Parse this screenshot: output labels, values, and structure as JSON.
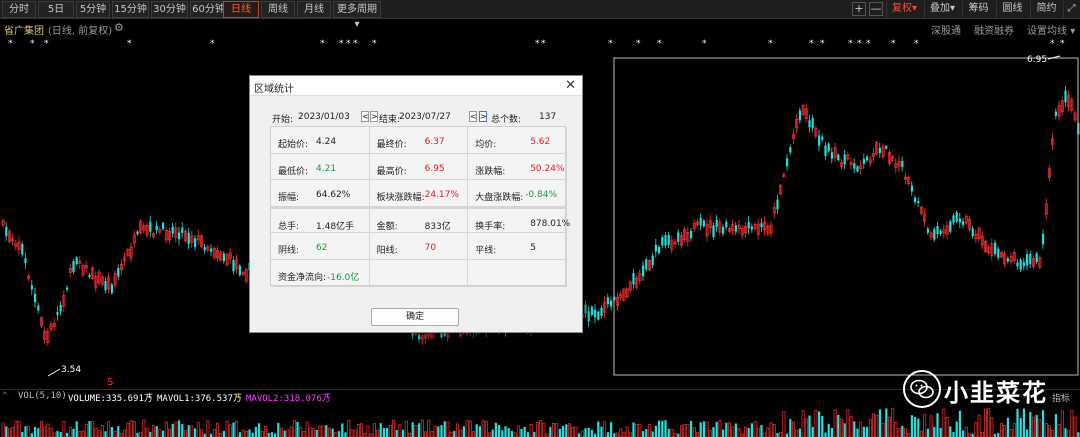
{
  "toolbar": {
    "periods": [
      "分时",
      "5日",
      "5分钟",
      "15分钟",
      "30分钟",
      "60分钟",
      "日线",
      "周线",
      "月线",
      "更多周期"
    ],
    "active_period": "日线",
    "right": {
      "plus": "+",
      "minus": "—",
      "adjust": "复权",
      "overlay": "叠加",
      "chips": "筹码",
      "circle": "圆线",
      "brief": "简约",
      "zoom": "⤢"
    }
  },
  "subbar": {
    "stock_name": "省广集团",
    "stock_sub": "(日线, 前复权)",
    "links": [
      "深股通",
      "融资融券",
      "设置均线"
    ]
  },
  "chart": {
    "low_label": "3.54",
    "high_label": "6.95",
    "signal_mark": "S",
    "star": "*"
  },
  "volume": {
    "label": "VOL(5,10)",
    "volume": "VOLUME:335.691万",
    "mavol1": "MAVOL1:376.537万",
    "mavol2": "MAVOL2:318.076万",
    "indicator": "指标"
  },
  "watermark": {
    "text": "小韭菜花"
  },
  "dialog": {
    "title": "区域统计",
    "close": "✕",
    "start_label": "开始:",
    "start_date": "2023/01/03",
    "end_label": "结束:",
    "end_date": "2023/07/27",
    "count_label": "总个数:",
    "count": "137",
    "prev": "<",
    "next": ">",
    "rows": [
      [
        {
          "k": "起始价:",
          "v": "4.24",
          "c": "dark"
        },
        {
          "k": "最终价:",
          "v": "6.37",
          "c": "red"
        },
        {
          "k": "均价:",
          "v": "5.62",
          "c": "red"
        }
      ],
      [
        {
          "k": "最低价:",
          "v": "4.21",
          "c": "green"
        },
        {
          "k": "最高价:",
          "v": "6.95",
          "c": "red"
        },
        {
          "k": "涨跌幅:",
          "v": "50.24%",
          "c": "red"
        }
      ],
      [
        {
          "k": "振幅:",
          "v": "64.62%",
          "c": "dark"
        },
        {
          "k": "板块涨跌幅:",
          "v": "24.17%",
          "c": "red"
        },
        {
          "k": "大盘涨跌幅:",
          "v": "-0.84%",
          "c": "green"
        }
      ],
      [
        {
          "k": "总手:",
          "v": "1.48亿手",
          "c": "dark"
        },
        {
          "k": "金额:",
          "v": "833亿",
          "c": "dark"
        },
        {
          "k": "换手率:",
          "v": "878.01%",
          "c": "dark"
        }
      ],
      [
        {
          "k": "阴线:",
          "v": "62",
          "c": "green"
        },
        {
          "k": "阳线:",
          "v": "70",
          "c": "red"
        },
        {
          "k": "平线:",
          "v": "5",
          "c": "dark"
        }
      ],
      [
        {
          "k": "资金净流向:",
          "v": "-16.0亿",
          "c": "green"
        },
        {
          "k": "",
          "v": "",
          "c": "dark"
        },
        {
          "k": "",
          "v": "",
          "c": "dark"
        }
      ]
    ],
    "ok": "确定"
  },
  "colors": {
    "up": "#ff3030",
    "down": "#20e0e0",
    "accent": "#ff5a3a",
    "magenta": "#ff40ff",
    "yellow": "#ffd000"
  }
}
